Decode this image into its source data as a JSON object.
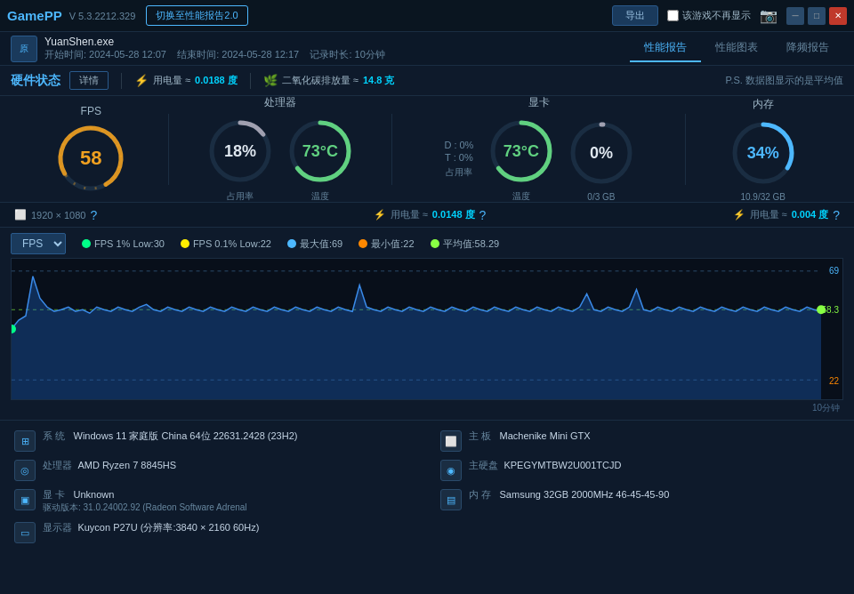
{
  "titlebar": {
    "logo_part1": "Game",
    "logo_part2": "PP",
    "version": "V 5.3.2212.329",
    "btn_switch": "切换至性能报告2.0",
    "btn_export": "导出",
    "checkbox_label": "该游戏不再显示",
    "btn_min": "─",
    "btn_max": "□",
    "btn_close": "✕"
  },
  "infobar": {
    "game_name": "YuanShen.exe",
    "start_time": "开始时间: 2024-05-28 12:07",
    "end_time": "结束时间: 2024-05-28 12:17",
    "duration": "记录时长: 10分钟",
    "tabs": [
      {
        "label": "性能报告",
        "active": true
      },
      {
        "label": "性能图表",
        "active": false
      },
      {
        "label": "降频报告",
        "active": false
      }
    ]
  },
  "statusbar": {
    "title": "硬件状态",
    "btn_detail": "详情",
    "power_label": "用电量 ≈",
    "power_value": "0.0188",
    "power_unit": "度",
    "co2_label": "二氧化碳排放量 ≈",
    "co2_value": "14.8",
    "co2_unit": "克",
    "ps_note": "P.S. 数据图显示的是平均值"
  },
  "metrics": {
    "fps": {
      "label": "FPS",
      "value": "58",
      "color": "#f0a020"
    },
    "cpu": {
      "label": "处理器",
      "usage_value": "18%",
      "usage_sub": "占用率",
      "temp_value": "73°C",
      "temp_sub": "温度",
      "usage_color": "#e0e8f0",
      "temp_color": "#60d080"
    },
    "gpu": {
      "label": "显卡",
      "d_label": "D : 0%",
      "t_label": "T : 0%",
      "usage_sub": "占用率",
      "temp_value": "73°C",
      "temp_sub": "温度",
      "vram_value": "0%",
      "vram_sub": "0/3 GB",
      "temp_color": "#60d080"
    },
    "mem": {
      "label": "内存",
      "value": "34%",
      "sub": "10.9/32 GB",
      "color": "#4db8ff"
    }
  },
  "subinfo": {
    "resolution": "1920 × 1080",
    "cpu_power_label": "用电量 ≈",
    "cpu_power_value": "0.0148",
    "cpu_power_unit": "度",
    "gpu_power_label": "用电量 ≈",
    "gpu_power_value": "0.004",
    "gpu_power_unit": "度"
  },
  "chart": {
    "select_label": "FPS",
    "legends": [
      {
        "label": "FPS 1% Low:30",
        "color": "#00ff88"
      },
      {
        "label": "FPS 0.1% Low:22",
        "color": "#ffee00"
      },
      {
        "label": "最大值:69",
        "color": "#4db8ff"
      },
      {
        "label": "最小值:22",
        "color": "#ff8800"
      },
      {
        "label": "平均值:58.29",
        "color": "#88ff44"
      }
    ],
    "y_max": "69",
    "y_avg": "58.3",
    "y_min": "22",
    "x_label": "10分钟"
  },
  "sysinfo": {
    "left": [
      {
        "icon": "⊞",
        "key": "系 统",
        "value": "Windows 11 家庭版 China 64位 22631.2428 (23H2)"
      },
      {
        "icon": "◎",
        "key": "处理器",
        "value": "AMD Ryzen 7 8845HS"
      },
      {
        "icon": "▣",
        "key": "显 卡",
        "value": "Unknown",
        "sub": "驱动版本: 31.0.24002.92 (Radeon Software Adrenal"
      },
      {
        "icon": "▭",
        "key": "显示器",
        "value": "Kuycon P27U (分辨率:3840 × 2160 60Hz)"
      }
    ],
    "right": [
      {
        "icon": "⬜",
        "key": "主 板",
        "value": "Machenike Mini GTX"
      },
      {
        "icon": "◉",
        "key": "主硬盘",
        "value": "KPEGYMTBW2U001TCJD"
      },
      {
        "icon": "▤",
        "key": "内 存",
        "value": "Samsung 32GB 2000MHz 46-45-45-90"
      }
    ]
  }
}
